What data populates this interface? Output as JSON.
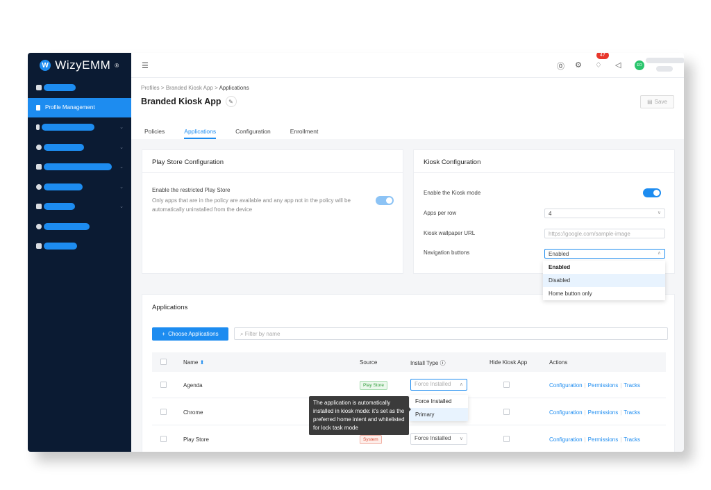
{
  "app": {
    "brand": "WizyEMM",
    "brand_mark": "W",
    "brand_sup": "®"
  },
  "sidebar": {
    "active_label": "Profile Management"
  },
  "topbar": {
    "notification_count": "47",
    "avatar_initials": "EO"
  },
  "breadcrumb": {
    "items": [
      "Profiles",
      "Branded Kiosk App",
      "Applications"
    ],
    "separator": ">"
  },
  "page": {
    "title": "Branded Kiosk App",
    "save_label": "Save"
  },
  "tabs": [
    "Policies",
    "Applications",
    "Configuration",
    "Enrollment"
  ],
  "play_store": {
    "title": "Play Store Configuration",
    "label": "Enable the restricted Play Store",
    "description": "Only apps that are in the policy are available and any app not in the policy will be automatically uninstalled from the device",
    "enabled": true
  },
  "kiosk": {
    "title": "Kiosk Configuration",
    "mode_label": "Enable the Kiosk mode",
    "mode_enabled": true,
    "apps_per_row_label": "Apps per row",
    "apps_per_row_value": "4",
    "wallpaper_label": "Kiosk wallpaper URL",
    "wallpaper_placeholder": "https://google.com/sample-image",
    "nav_label": "Navigation buttons",
    "nav_value": "Enabled",
    "nav_options": [
      "Enabled",
      "Disabled",
      "Home button only"
    ]
  },
  "applications": {
    "title": "Applications",
    "choose_label": "Choose Applications",
    "filter_placeholder": "Filter by name",
    "columns": [
      "Name",
      "Source",
      "Install Type",
      "Hide Kiosk App",
      "Actions"
    ],
    "rows": [
      {
        "name": "Agenda",
        "source": "Play Store",
        "install": "Force Installed"
      },
      {
        "name": "Chrome",
        "source": "",
        "install": ""
      },
      {
        "name": "Play Store",
        "source": "System",
        "install": "Force Installed"
      }
    ],
    "actions": [
      "Configuration",
      "Permissions",
      "Tracks"
    ],
    "install_options": [
      "Force Installed",
      "Primary"
    ],
    "tooltip": "The application is automatically installed in kiosk mode: it's set as the preferred home intent and whitelisted for lock task mode"
  },
  "colors": {
    "sidebar": "#0b1b33",
    "accent": "#1d8cf0",
    "badge_red": "#e8372c",
    "avatar": "#2ac56d"
  },
  "icons": [
    "help-icon",
    "gear-icon",
    "bell-icon",
    "megaphone-icon",
    "pencil-icon",
    "save-icon",
    "plus-icon",
    "search-icon",
    "sort-up-icon",
    "chevron-down-icon"
  ]
}
